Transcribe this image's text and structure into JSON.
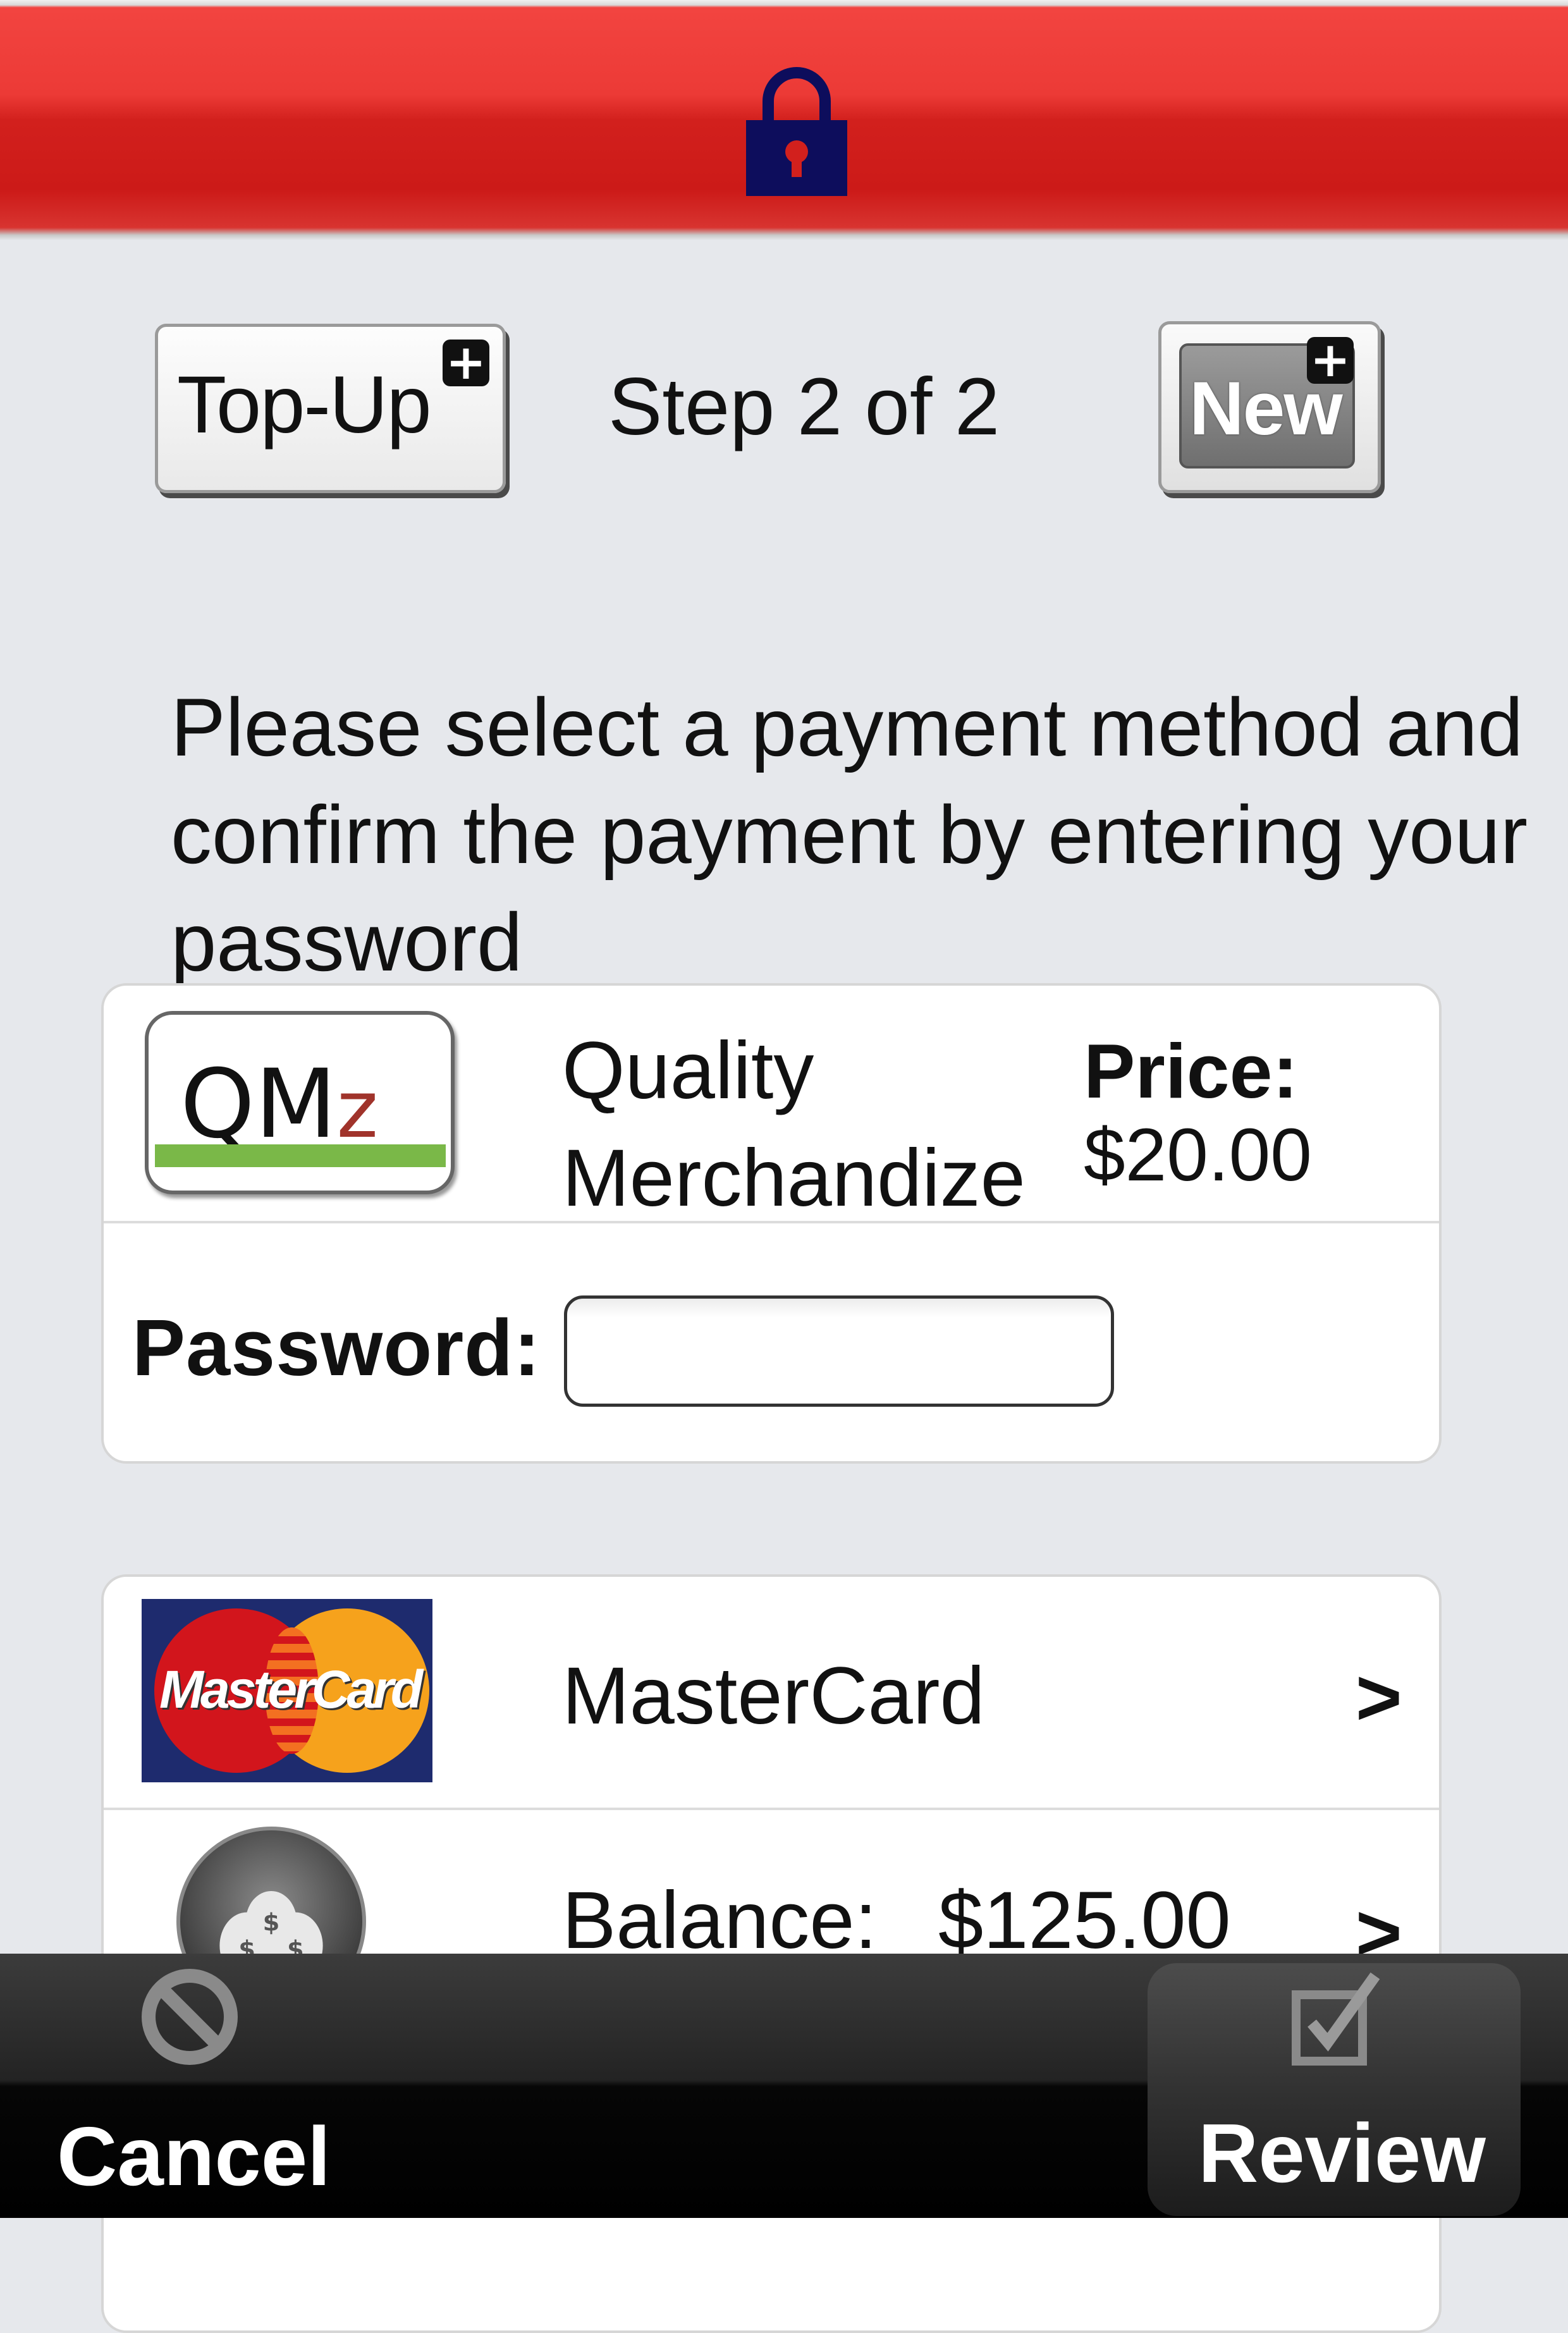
{
  "header": {
    "icon": "lock-icon",
    "color": "#e8302c"
  },
  "step_row": {
    "topup_label": "Top-Up",
    "step_text": "Step 2 of 2",
    "new_label": "New"
  },
  "instruction": "Please select a payment method and confirm the payment by entering your password",
  "merchant": {
    "logo_text_main": "QM",
    "logo_text_z": "z",
    "name": "Quality Merchandize",
    "price_label": "Price:",
    "price_value": "$20.00"
  },
  "password": {
    "label": "Password:",
    "value": "",
    "placeholder": ""
  },
  "payment_methods": [
    {
      "label": "MasterCard",
      "logo_text": "MasterCard",
      "chevron": ">"
    },
    {
      "label": "Balance:",
      "value": "$125.00",
      "chevron": ">"
    }
  ],
  "toolbar": {
    "cancel_label": "Cancel",
    "review_label": "Review"
  }
}
